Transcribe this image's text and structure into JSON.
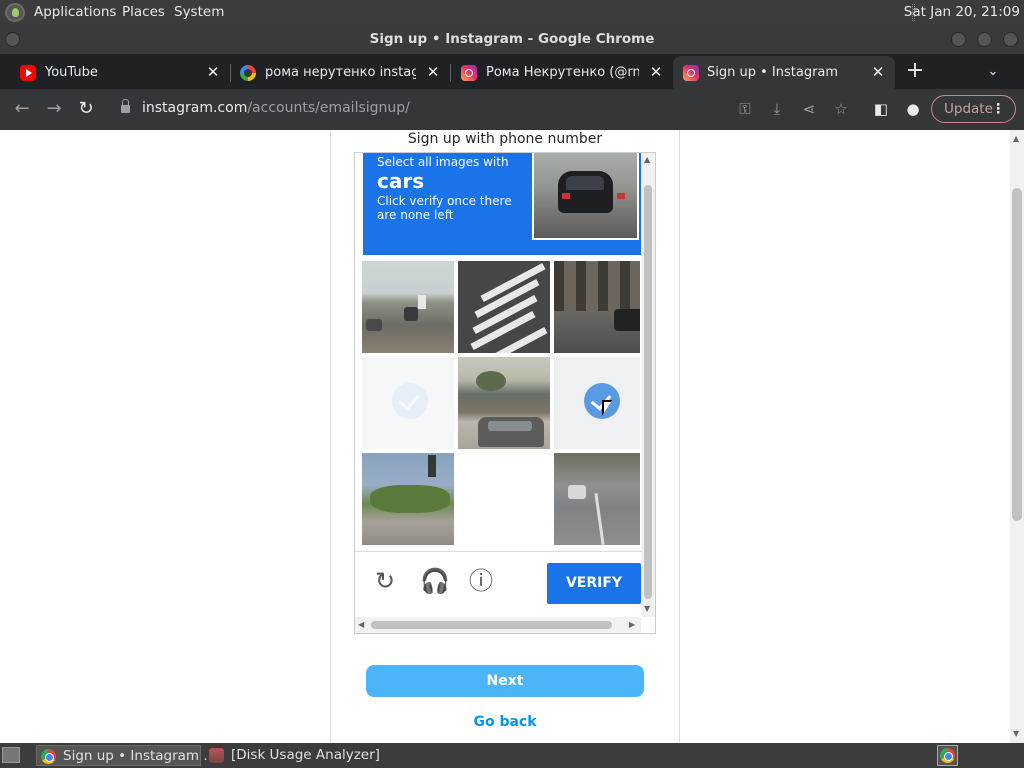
{
  "topbar": {
    "menus": [
      "Applications",
      "Places",
      "System"
    ],
    "clock": "Sat Jan 20, 21:09"
  },
  "window": {
    "title": "Sign up • Instagram - Google Chrome"
  },
  "tabs": [
    {
      "label": "YouTube",
      "favicon": "youtube-icon"
    },
    {
      "label": "рома нерутенко instagram",
      "favicon": "google-icon"
    },
    {
      "label": "Рома Некрутенко (@rnekrutenko)",
      "favicon": "instagram-icon"
    },
    {
      "label": "Sign up • Instagram",
      "favicon": "instagram-icon",
      "active": true
    }
  ],
  "toolbar": {
    "url_host": "instagram.com",
    "url_path": "/accounts/emailsignup/",
    "update_label": "Update"
  },
  "page": {
    "signup_heading": "Sign up with phone number",
    "next_label": "Next",
    "go_back_label": "Go back"
  },
  "captcha": {
    "instruction_line1": "Select all images with",
    "target": "cars",
    "instruction_line2": "Click verify once there are none left",
    "verify_label": "VERIFY",
    "accent_color": "#1a73e8",
    "tiles": [
      {
        "content": "highway",
        "state": "normal"
      },
      {
        "content": "crosswalk",
        "state": "normal"
      },
      {
        "content": "street-car",
        "state": "normal"
      },
      {
        "content": "fading",
        "state": "fading"
      },
      {
        "content": "suv",
        "state": "normal"
      },
      {
        "content": "selected",
        "state": "selected"
      },
      {
        "content": "park-road",
        "state": "normal"
      },
      {
        "content": "blank",
        "state": "loading"
      },
      {
        "content": "road-cars",
        "state": "normal"
      }
    ]
  },
  "taskbar": {
    "items": [
      "Sign up • Instagram ...",
      "[Disk Usage Analyzer]"
    ]
  }
}
